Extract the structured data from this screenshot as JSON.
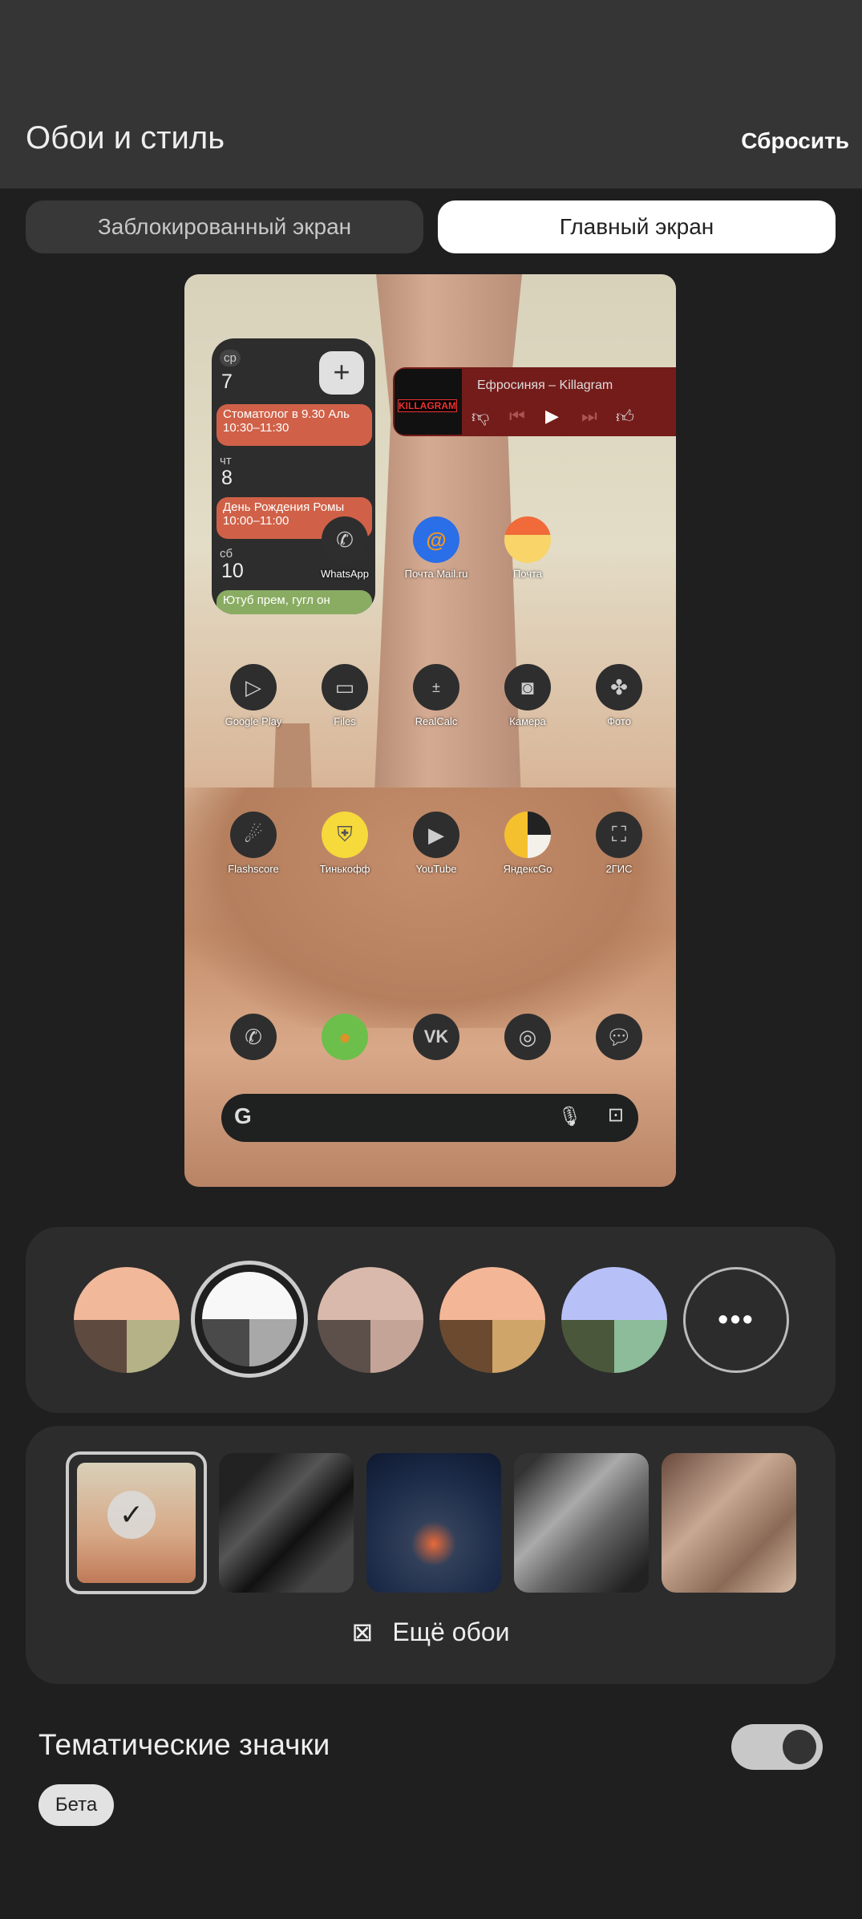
{
  "header": {
    "title": "Обои и стиль",
    "reset": "Сбросить"
  },
  "tabs": [
    {
      "label": "Заблокированный экран",
      "selected": false
    },
    {
      "label": "Главный экран",
      "selected": true
    }
  ],
  "calendar": {
    "add": "+",
    "days": [
      {
        "day": "ср",
        "num": "7",
        "event": {
          "title": "Стоматолог в 9.30 Аль",
          "time": "10:30–11:30",
          "color": "#d06148"
        }
      },
      {
        "day": "чт",
        "num": "8",
        "event": {
          "title": "День Рождения Ромы",
          "time": "10:00–11:00",
          "color": "#d06148"
        }
      },
      {
        "day": "сб",
        "num": "10",
        "event": {
          "title": "Ютуб прем, гугл он",
          "time": "",
          "color": "#8aac62"
        }
      }
    ]
  },
  "music": {
    "song": "Ефросиняя – Killagram",
    "album_art": "KILLAGRAM"
  },
  "apps_row1": [
    {
      "label": "WhatsApp",
      "icon": "whatsapp-icon"
    },
    {
      "label": "Почта Mail.ru",
      "icon": "mail-ru-icon"
    },
    {
      "label": "Почта",
      "icon": "yandex-mail-icon"
    }
  ],
  "apps_row2": [
    {
      "label": "Google Play",
      "icon": "play-store-icon"
    },
    {
      "label": "Files",
      "icon": "files-icon"
    },
    {
      "label": "RealCalc",
      "icon": "calculator-icon"
    },
    {
      "label": "Камера",
      "icon": "camera-icon"
    },
    {
      "label": "Фото",
      "icon": "photos-icon"
    }
  ],
  "apps_row3": [
    {
      "label": "Flashscore",
      "icon": "flashscore-icon"
    },
    {
      "label": "Тинькофф",
      "icon": "tinkoff-icon"
    },
    {
      "label": "YouTube",
      "icon": "youtube-icon"
    },
    {
      "label": "ЯндексGo",
      "icon": "yandex-go-icon"
    },
    {
      "label": "2ГИС",
      "icon": "2gis-icon"
    }
  ],
  "dock": [
    "phone-icon",
    "app-icon",
    "vk-icon",
    "chrome-icon",
    "messages-icon"
  ],
  "search": {
    "logo": "G"
  },
  "palettes": [
    {
      "top": "#f2b89a",
      "bl": "#5f4a40",
      "br": "#b4b286",
      "selected": false
    },
    {
      "top": "#f8f8f8",
      "bl": "#4a4a4a",
      "br": "#a8a8a8",
      "selected": true
    },
    {
      "top": "#d9b9ab",
      "bl": "#5d504b",
      "br": "#c5a498",
      "selected": false
    },
    {
      "top": "#f3b697",
      "bl": "#6b4a30",
      "br": "#d0a56a",
      "selected": false
    },
    {
      "top": "#b8c0f8",
      "bl": "#4a573a",
      "br": "#8cbc9a",
      "selected": false
    }
  ],
  "more_colors": "•••",
  "wallpapers_more": "Ещё обои",
  "themed_icons": {
    "label": "Тематические значки",
    "badge": "Бета",
    "enabled": true
  }
}
